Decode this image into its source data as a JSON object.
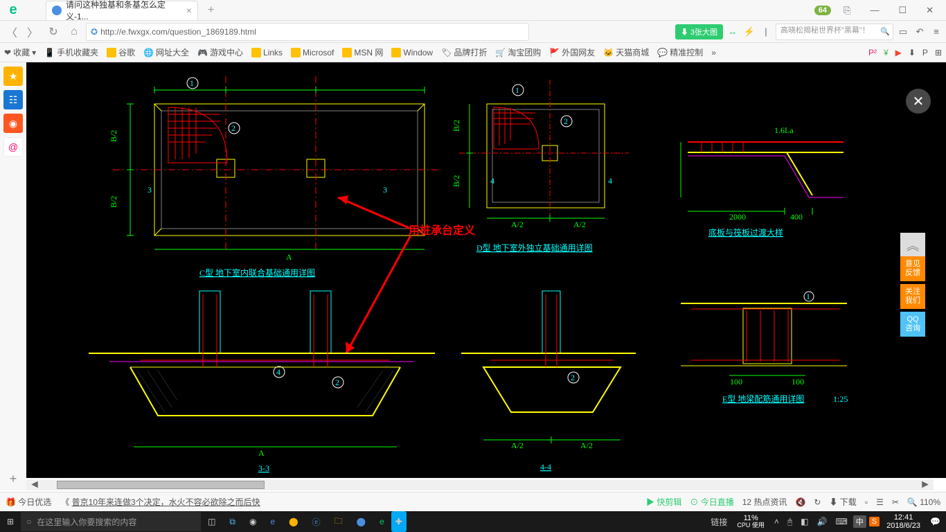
{
  "title": {
    "tab": "请问这种独基和条基怎么定义-1..."
  },
  "url": "http://e.fwxgx.com/question_1869189.html",
  "badge_top": "64",
  "addr": {
    "pill": "⬇ 3张大图",
    "search_placeholder": "高晓松揭秘世界杯\"黑幕\"！"
  },
  "bookmarks": {
    "fav": "收藏",
    "mobile": "手机收藏夹",
    "items": [
      "谷歌",
      "网址大全",
      "游戏中心",
      "Links",
      "Microsof",
      "MSN 网",
      "Window",
      "品牌打折",
      "淘宝团购",
      "外国网友",
      "天猫商城",
      "精准控制"
    ]
  },
  "cad": {
    "annot": "用桩承台定义",
    "labels": {
      "c_title": "C型 地下室内联合基础通用详图",
      "d_title": "D型 地下室外独立基础通用详图",
      "bottom_title": "底板与筏板过渡大样",
      "e_title": "E型 地梁配筋通用详图",
      "e_scale": "1:25",
      "sec33": "3-3",
      "sec44": "4-4",
      "dim2000": "2000",
      "dim400": "400",
      "dim100a": "100",
      "dim100b": "100",
      "la16": "1.6La",
      "dimA": "A",
      "dimA2a": "A/2",
      "dimA2b": "A/2",
      "dimB2a": "B/2",
      "dimB2b": "B/2",
      "num1": "1",
      "num2": "2",
      "num3": "3",
      "num4": "4"
    }
  },
  "float": {
    "top": "︽",
    "fb": "意见\n反馈",
    "follow": "关注\n我们",
    "qq": "QQ\n咨询"
  },
  "bottom": {
    "today": "今日优选",
    "news": "普京10年来连做3个决定，水火不容必欲除之而后快",
    "clip": "快剪辑",
    "live": "今日直播",
    "hot": "热点资讯",
    "dl_icon": "下载",
    "zoom": "110%"
  },
  "taskbar": {
    "search_placeholder": "在这里输入你要搜索的内容",
    "link": "链接",
    "cpu_pct": "11%",
    "cpu_txt": "CPU 使用",
    "ime": "中",
    "s": "S",
    "time": "12:41",
    "date": "2018/6/23"
  }
}
